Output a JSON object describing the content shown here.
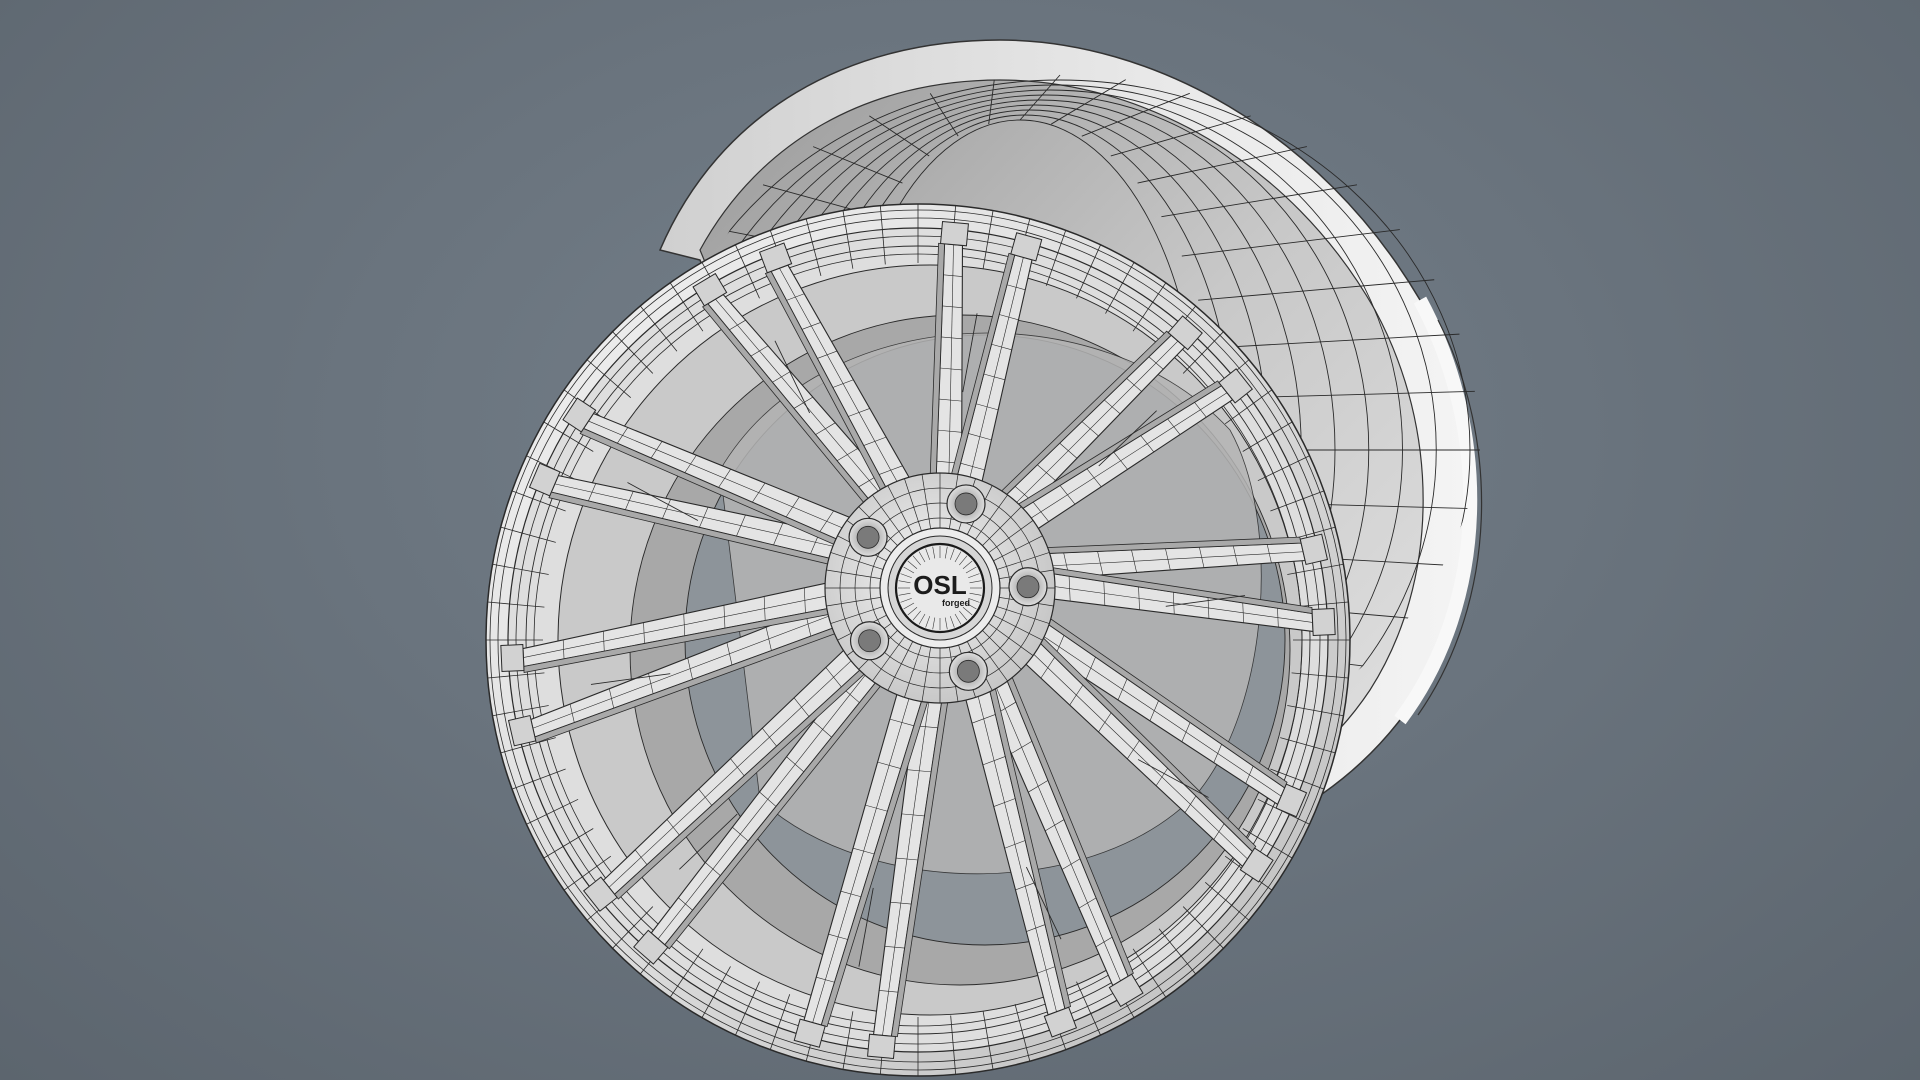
{
  "viewport": {
    "background": "#6a747e",
    "wireframe_color": "#2a2a2a",
    "surface_color": "#e3e3e3",
    "shadow_color": "#9c9c9c"
  },
  "model": {
    "hub_logo_text": "OSL",
    "hub_logo_sub": "forged",
    "spoke_pairs": 10
  }
}
